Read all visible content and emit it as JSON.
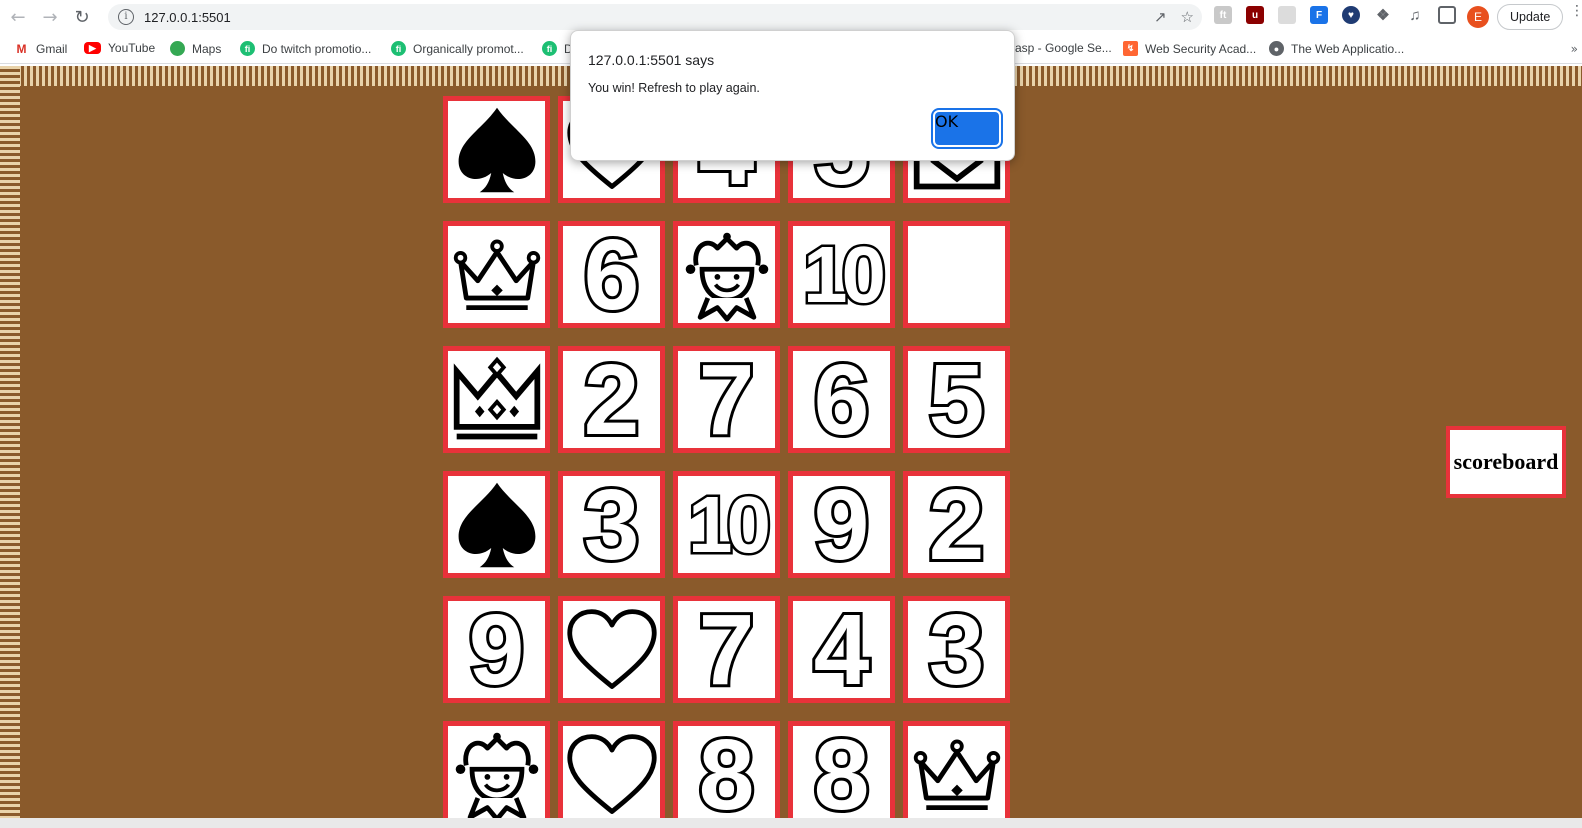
{
  "browser": {
    "url": "127.0.0.1:5501",
    "update_label": "Update",
    "profile_initial": "E"
  },
  "bookmarks": [
    {
      "label": "Gmail",
      "icon": "gmail-icon"
    },
    {
      "label": "YouTube",
      "icon": "youtube-icon"
    },
    {
      "label": "Maps",
      "icon": "maps-icon"
    },
    {
      "label": "Do twitch promotio...",
      "icon": "fi-icon"
    },
    {
      "label": "Organically promot...",
      "icon": "fi-icon"
    },
    {
      "label": "D",
      "icon": "fi-icon"
    },
    {
      "label": "asp - Google Se...",
      "icon": ""
    },
    {
      "label": "Web Security Acad...",
      "icon": "portswigger-icon"
    },
    {
      "label": "The Web Applicatio...",
      "icon": "globe-icon"
    }
  ],
  "dialog": {
    "title": "127.0.0.1:5501 says",
    "message": "You win! Refresh to play again.",
    "ok_label": "OK"
  },
  "game": {
    "cards": [
      [
        "spade",
        "heart",
        "4",
        "5",
        "king"
      ],
      [
        "queen-crown",
        "6",
        "joker",
        "10",
        "blank"
      ],
      [
        "king-crown",
        "2",
        "7",
        "6",
        "5"
      ],
      [
        "spade",
        "3",
        "10",
        "9",
        "2"
      ],
      [
        "9",
        "heart",
        "7",
        "4",
        "3"
      ],
      [
        "joker",
        "heart",
        "8",
        "8",
        "queen-crown"
      ]
    ],
    "scoreboard_label": "scoreboard"
  },
  "colors": {
    "background": "#8a5a2b",
    "card_border": "#e8323a",
    "stripe": "#e9d3aa"
  }
}
